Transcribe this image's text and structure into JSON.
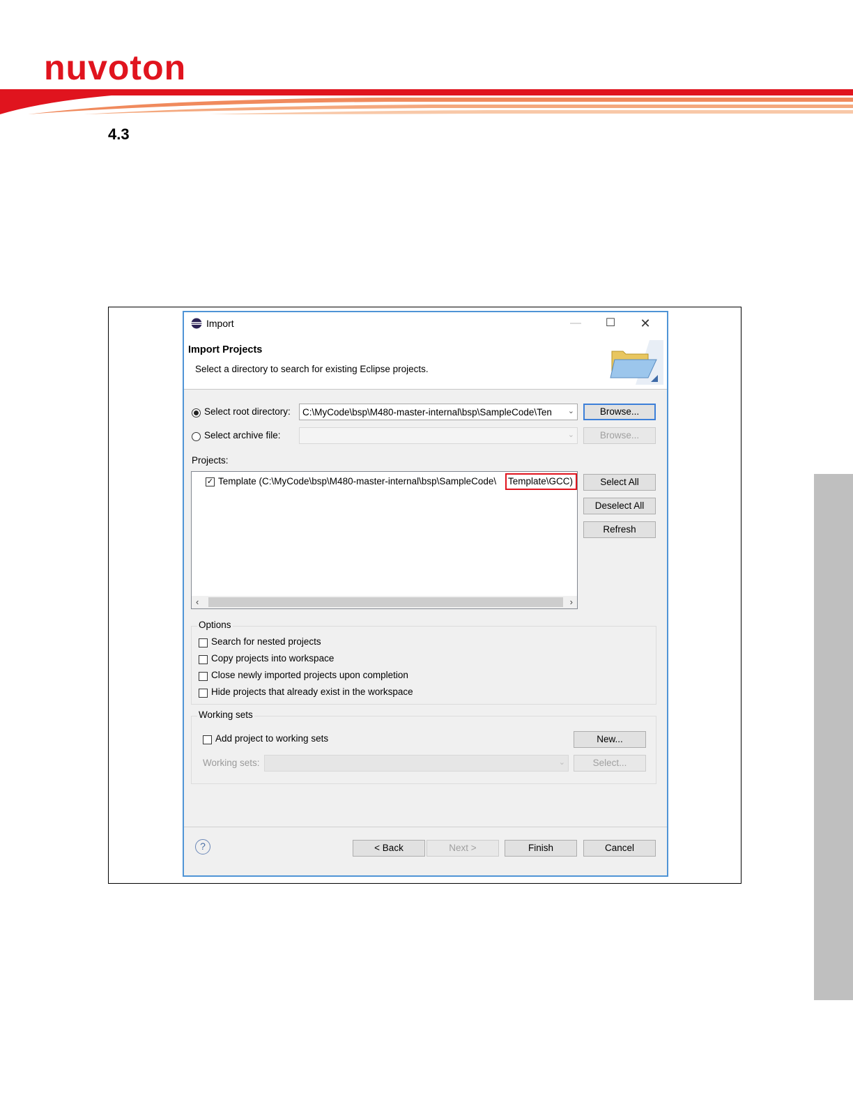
{
  "document": {
    "logo_text": "nuvoton",
    "section_number": "4.3"
  },
  "dialog": {
    "window_title": "Import",
    "header_title": "Import Projects",
    "header_description": "Select a directory to search for existing Eclipse projects.",
    "root_directory": {
      "label": "Select root directory:",
      "selected": true,
      "value": "C:\\MyCode\\bsp\\M480-master-internal\\bsp\\SampleCode\\Ten",
      "browse_label": "Browse..."
    },
    "archive_file": {
      "label": "Select archive file:",
      "selected": false,
      "value": "",
      "browse_label": "Browse..."
    },
    "projects_label": "Projects:",
    "projects": [
      {
        "checked": true,
        "text": "Template (C:\\MyCode\\bsp\\M480-master-internal\\bsp\\SampleCode\\",
        "highlighted_text": "Template\\GCC)"
      }
    ],
    "project_buttons": {
      "select_all": "Select All",
      "deselect_all": "Deselect All",
      "refresh": "Refresh"
    },
    "options": {
      "title": "Options",
      "items": [
        {
          "label": "Search for nested projects",
          "checked": false
        },
        {
          "label": "Copy projects into workspace",
          "checked": false
        },
        {
          "label": "Close newly imported projects upon completion",
          "checked": false
        },
        {
          "label": "Hide projects that already exist in the workspace",
          "checked": false
        }
      ]
    },
    "working_sets": {
      "title": "Working sets",
      "add_label": "Add project to working sets",
      "add_checked": false,
      "new_label": "New...",
      "sets_label": "Working sets:",
      "select_label": "Select..."
    },
    "footer": {
      "help_icon": "?",
      "back": "< Back",
      "next": "Next >",
      "finish": "Finish",
      "cancel": "Cancel"
    }
  },
  "colors": {
    "brand_red": "#e0141e",
    "dialog_border": "#4f94d6",
    "highlight_box": "#e0141e"
  }
}
